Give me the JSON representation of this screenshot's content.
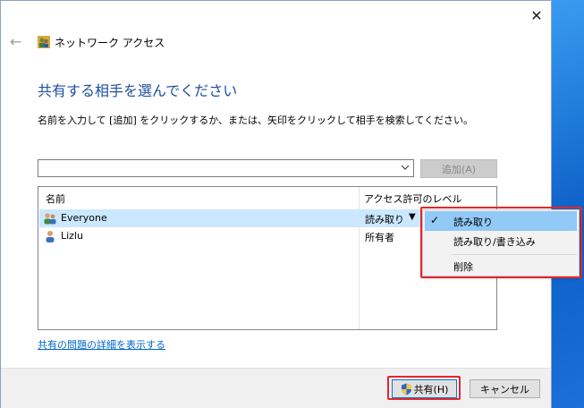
{
  "window": {
    "title": "ネットワーク アクセス",
    "close_glyph": "✕",
    "back_glyph": "←"
  },
  "heading": "共有する相手を選んでください",
  "instruction": "名前を入力して [追加] をクリックするか、または、矢印をクリックして相手を検索してください。",
  "input": {
    "value": "",
    "placeholder": ""
  },
  "add_button": "追加(A)",
  "list": {
    "headers": {
      "name": "名前",
      "level": "アクセス許可のレベル"
    },
    "rows": [
      {
        "name": "Everyone",
        "level": "読み取り",
        "dropdown": "▼",
        "selected": true,
        "icon": "users-icon"
      },
      {
        "name": "Lizlu",
        "level": "所有者",
        "selected": false,
        "icon": "user-icon"
      }
    ]
  },
  "context_menu": {
    "items": [
      {
        "label": "読み取り",
        "checked": true
      },
      {
        "label": "読み取り/書き込み",
        "checked": false
      },
      {
        "label": "削除",
        "checked": false
      }
    ],
    "check_glyph": "✓"
  },
  "link": "共有の問題の詳細を表示する",
  "buttons": {
    "share": "共有(H)",
    "cancel": "キャンセル"
  },
  "colors": {
    "heading": "#1d4fa0",
    "selection": "#cce8ff",
    "menu_selection": "#91c9f7",
    "highlight": "#e5262b",
    "link": "#0066cc"
  }
}
